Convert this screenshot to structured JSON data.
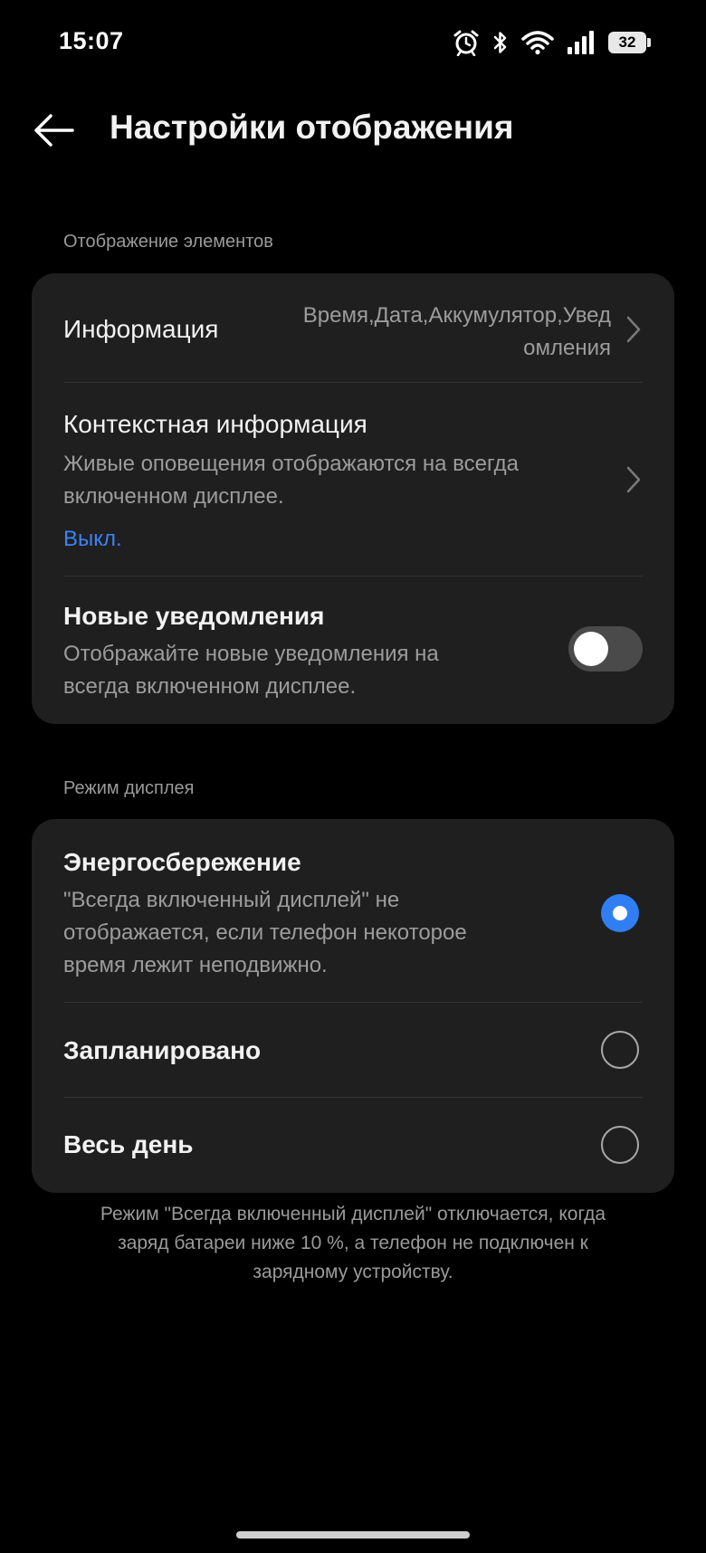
{
  "status_bar": {
    "time": "15:07",
    "battery_level": "32",
    "icons": [
      "alarm-icon",
      "bluetooth-icon",
      "wifi-icon",
      "signal-icon",
      "battery-icon"
    ]
  },
  "header": {
    "title": "Настройки отображения",
    "back_icon": "arrow-left-icon"
  },
  "sections": {
    "elements": {
      "label": "Отображение элементов",
      "information": {
        "title": "Информация",
        "value_line1": "Время,Дата,Аккумулятор,Увед",
        "value_line2": "омления"
      },
      "context": {
        "title": "Контекстная информация",
        "desc_line1": "Живые оповещения отображаются на всегда",
        "desc_line2": "включенном дисплее.",
        "status": "Выкл."
      },
      "new_notifications": {
        "title": "Новые уведомления",
        "desc_line1": "Отображайте новые уведомления на",
        "desc_line2": "всегда включенном дисплее.",
        "enabled": false
      }
    },
    "display_mode": {
      "label": "Режим дисплея",
      "options": [
        {
          "title": "Энергосбережение",
          "desc_line1": "\"Всегда включенный дисплей\" не",
          "desc_line2": "отображается, если телефон некоторое",
          "desc_line3": "время лежит неподвижно.",
          "selected": true
        },
        {
          "title": "Запланировано",
          "selected": false
        },
        {
          "title": "Весь день",
          "selected": false
        }
      ]
    }
  },
  "footer": {
    "line1": "Режим \"Всегда включенный дисплей\" отключается, когда",
    "line2": "заряд батареи ниже 10 %, а телефон не подключен к",
    "line3": "зарядному устройству."
  },
  "colors": {
    "background": "#000000",
    "card": "#1f1f1f",
    "accent": "#2f7ff2",
    "link": "#3b82f6",
    "secondary_text": "#9c9c9c"
  }
}
